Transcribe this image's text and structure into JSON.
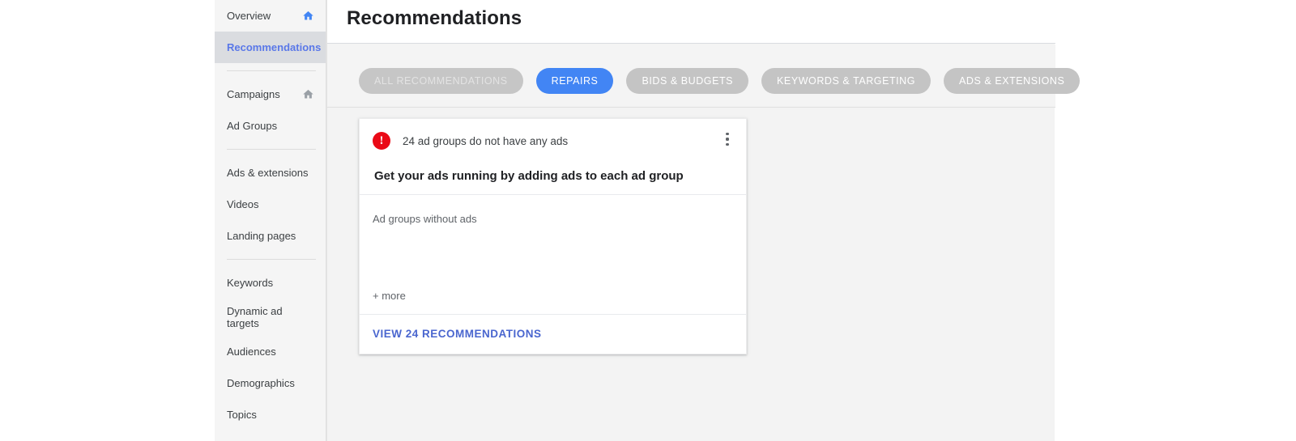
{
  "sidebar": {
    "items": [
      {
        "label": "Overview",
        "icon": "home-icon",
        "icon_state": "blue",
        "active": false,
        "name": "overview"
      },
      {
        "label": "Recommendations",
        "icon": null,
        "icon_state": null,
        "active": true,
        "name": "recommendations"
      },
      {
        "separator_after": true
      },
      {
        "label": "Campaigns",
        "icon": "home-icon",
        "icon_state": "gray",
        "active": false,
        "name": "campaigns"
      },
      {
        "label": "Ad Groups",
        "icon": null,
        "icon_state": null,
        "active": false,
        "name": "ad-groups"
      },
      {
        "separator_after": true
      },
      {
        "label": "Ads & extensions",
        "icon": null,
        "icon_state": null,
        "active": false,
        "name": "ads-extensions"
      },
      {
        "label": "Videos",
        "icon": null,
        "icon_state": null,
        "active": false,
        "name": "videos"
      },
      {
        "label": "Landing pages",
        "icon": null,
        "icon_state": null,
        "active": false,
        "name": "landing-pages"
      },
      {
        "separator_after": true
      },
      {
        "label": "Keywords",
        "icon": null,
        "icon_state": null,
        "active": false,
        "name": "keywords"
      },
      {
        "label": "Dynamic ad targets",
        "icon": null,
        "icon_state": null,
        "active": false,
        "name": "dynamic-ad-targets"
      },
      {
        "label": "Audiences",
        "icon": null,
        "icon_state": null,
        "active": false,
        "name": "audiences"
      },
      {
        "label": "Demographics",
        "icon": null,
        "icon_state": null,
        "active": false,
        "name": "demographics"
      },
      {
        "label": "Topics",
        "icon": null,
        "icon_state": null,
        "active": false,
        "name": "topics"
      }
    ]
  },
  "header": {
    "title": "Recommendations"
  },
  "filters": {
    "chips": [
      {
        "label": "ALL RECOMMENDATIONS",
        "state": "muted",
        "name": "chip-all-recommendations"
      },
      {
        "label": "REPAIRS",
        "state": "selected",
        "name": "chip-repairs"
      },
      {
        "label": "BIDS & BUDGETS",
        "state": "normal",
        "name": "chip-bids-budgets"
      },
      {
        "label": "KEYWORDS & TARGETING",
        "state": "normal",
        "name": "chip-keywords-targeting"
      },
      {
        "label": "ADS & EXTENSIONS",
        "state": "normal",
        "name": "chip-ads-extensions"
      }
    ]
  },
  "card": {
    "alert_icon": "error-exclamation-icon",
    "alert_text": "24 ad groups do not have any ads",
    "headline": "Get your ads running by adding ads to each ad group",
    "body_label": "Ad groups without ads",
    "more_label": "+ more",
    "footer_link": "VIEW 24 RECOMMENDATIONS",
    "menu_icon": "kebab-menu-icon"
  },
  "colors": {
    "accent_blue": "#4285f4",
    "link_blue": "#4a66cf",
    "active_nav_blue": "#5a78e8",
    "alert_red": "#ea0a16",
    "chip_gray": "#c4c4c4",
    "panel_bg": "#f3f3f3",
    "sidebar_bg": "#f5f5f5",
    "active_nav_bg": "#dadce0"
  }
}
